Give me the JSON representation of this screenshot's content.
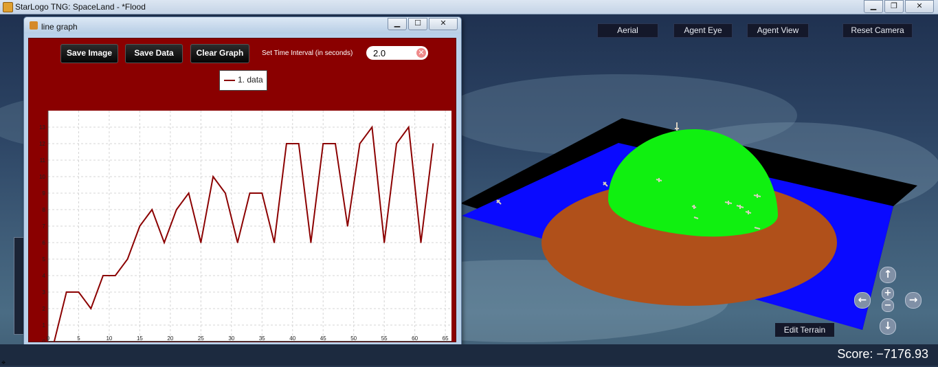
{
  "os_window": {
    "title": "StarLogo TNG: SpaceLand - *Flood",
    "controls": [
      "minimize",
      "maximize",
      "close"
    ]
  },
  "camera_buttons": [
    {
      "label": "Aerial",
      "active": true
    },
    {
      "label": "Agent Eye",
      "active": false
    },
    {
      "label": "Agent View",
      "active": false
    },
    {
      "label": "Reset Camera",
      "active": false
    }
  ],
  "graph_window": {
    "title": "line graph",
    "save_image_label": "Save Image",
    "save_data_label": "Save Data",
    "clear_graph_label": "Clear Graph",
    "interval_label": "Set Time Interval (in seconds)",
    "interval_value": "2.0",
    "legend_label": "1. data",
    "colors": {
      "panel": "#8a0000",
      "line": "#8b0000"
    }
  },
  "chart_data": {
    "type": "line",
    "series": [
      {
        "name": "1. data",
        "x": [
          1,
          3,
          5,
          7,
          9,
          11,
          13,
          15,
          17,
          19,
          21,
          23,
          25,
          27,
          29,
          31,
          33,
          35,
          37,
          39,
          41,
          43,
          45,
          47,
          49,
          51,
          53,
          55,
          57,
          59,
          61,
          63
        ],
        "values": [
          0,
          3,
          3,
          2,
          4,
          4,
          5,
          7,
          8,
          6,
          8,
          9,
          6,
          10,
          9,
          6,
          9,
          9,
          6,
          12,
          12,
          6,
          12,
          12,
          7,
          12,
          13,
          6,
          12,
          13,
          6,
          12
        ]
      }
    ],
    "xlim": [
      0,
      66
    ],
    "ylim": [
      0,
      14
    ],
    "x_ticks": [
      0,
      5,
      10,
      15,
      20,
      25,
      30,
      35,
      40,
      45,
      50,
      55,
      60,
      65
    ],
    "y_ticks": [
      0,
      1,
      2,
      3,
      4,
      5,
      6,
      7,
      8,
      9,
      10,
      11,
      12,
      13
    ],
    "grid": true,
    "legend": "top-center"
  },
  "edit_terrain_label": "Edit Terrain",
  "nav": {
    "up": "↑",
    "down": "↓",
    "left": "←",
    "right": "→",
    "zoom_in": "+",
    "zoom_out": "−"
  },
  "score_text": "Score: −7176.93",
  "scene_colors": {
    "water": "#0a0aff",
    "sand": "#b0501a",
    "hill": "#10f010",
    "border": "#000000"
  }
}
